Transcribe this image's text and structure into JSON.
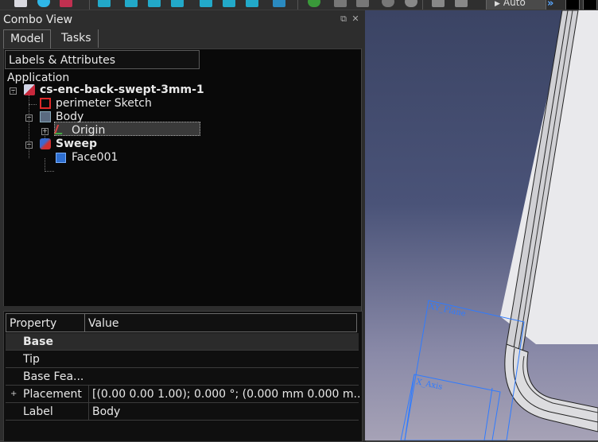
{
  "toolbar": {
    "icons": [
      "document-icon",
      "zoom-icon",
      "view-cube-icon",
      "view-iso-icon",
      "view-front-icon",
      "view-top-icon",
      "view-right-icon",
      "view-rear-icon",
      "view-bottom-icon",
      "view-left-icon",
      "measure-icon",
      "web-icon",
      "arrow-left-icon",
      "arrow-right-icon",
      "refresh-icon",
      "stop-icon",
      "plus-icon",
      "minus-icon"
    ],
    "workbench_label": "Auto"
  },
  "combo_view": {
    "title": "Combo View",
    "tabs": [
      {
        "label": "Model",
        "active": true
      },
      {
        "label": "Tasks",
        "active": false
      }
    ]
  },
  "tree": {
    "header": "Labels & Attributes",
    "root_label": "Application",
    "nodes": [
      {
        "label": "cs-enc-back-swept-3mm-1",
        "icon": "document-icon",
        "bold": true,
        "expander": "−"
      },
      {
        "label": "perimeter Sketch",
        "icon": "sketch-icon",
        "bold": false
      },
      {
        "label": "Body",
        "icon": "body-icon",
        "bold": false,
        "expander": "−",
        "selected": true
      },
      {
        "label": "Origin",
        "icon": "origin-icon",
        "bold": false,
        "expander": "+"
      },
      {
        "label": "Sweep",
        "icon": "sweep-icon",
        "bold": true,
        "expander": "−"
      },
      {
        "label": "Face001",
        "icon": "face-icon",
        "bold": false
      }
    ]
  },
  "properties": {
    "headers": {
      "property": "Property",
      "value": "Value"
    },
    "group": "Base",
    "rows": [
      {
        "name": "Tip",
        "value": ""
      },
      {
        "name": "Base Fea...",
        "value": ""
      },
      {
        "name": "Placement",
        "value": "[(0.00 0.00 1.00); 0.000 °; (0.000 mm  0.000 m...",
        "expander": "+"
      },
      {
        "name": "Label",
        "value": "Body"
      }
    ]
  },
  "viewport": {
    "plane_labels": [
      "XY_Plane",
      "X_Axis"
    ],
    "colors": {
      "plane": "#2f7bff",
      "background_top": "#3b4464",
      "background_bottom": "#a6a2b6",
      "model_edge": "#cfcfcf"
    }
  }
}
